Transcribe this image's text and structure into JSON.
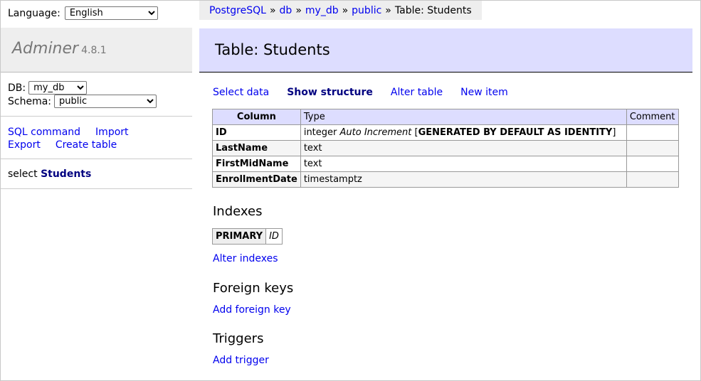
{
  "sidebar": {
    "language_label": "Language:",
    "language_value": "English",
    "app_name": "Adminer",
    "app_version": "4.8.1",
    "db_label": "DB:",
    "db_value": "my_db",
    "schema_label": "Schema:",
    "schema_value": "public",
    "links": {
      "sql_command": "SQL command",
      "import": "Import",
      "export": "Export",
      "create_table": "Create table"
    },
    "select_prefix": "select",
    "select_table": "Students"
  },
  "breadcrumb": {
    "items": [
      "PostgreSQL",
      "db",
      "my_db",
      "public"
    ],
    "separator": "»",
    "current": "Table: Students"
  },
  "page_title": "Table: Students",
  "actions": {
    "select_data": "Select data",
    "show_structure": "Show structure",
    "alter_table": "Alter table",
    "new_item": "New item"
  },
  "structure_table": {
    "headers": [
      "Column",
      "Type",
      "Comment"
    ],
    "rows": [
      {
        "column": "ID",
        "type": "integer",
        "type_extra": "Auto Increment",
        "type_bracket_open": "[",
        "type_generated": "GENERATED BY DEFAULT AS IDENTITY",
        "type_bracket_close": "]",
        "comment": ""
      },
      {
        "column": "LastName",
        "type": "text",
        "comment": ""
      },
      {
        "column": "FirstMidName",
        "type": "text",
        "comment": ""
      },
      {
        "column": "EnrollmentDate",
        "type": "timestamptz",
        "comment": ""
      }
    ]
  },
  "indexes": {
    "heading": "Indexes",
    "rows": [
      {
        "type": "PRIMARY",
        "columns": "ID"
      }
    ],
    "alter_link": "Alter indexes"
  },
  "foreign_keys": {
    "heading": "Foreign keys",
    "add_link": "Add foreign key"
  },
  "triggers": {
    "heading": "Triggers",
    "add_link": "Add trigger"
  },
  "colors": {
    "link": "#0000ee",
    "current_action": "#000080",
    "title_bg": "#ddddff",
    "sidebar_brand_bg": "#eeeeee"
  }
}
